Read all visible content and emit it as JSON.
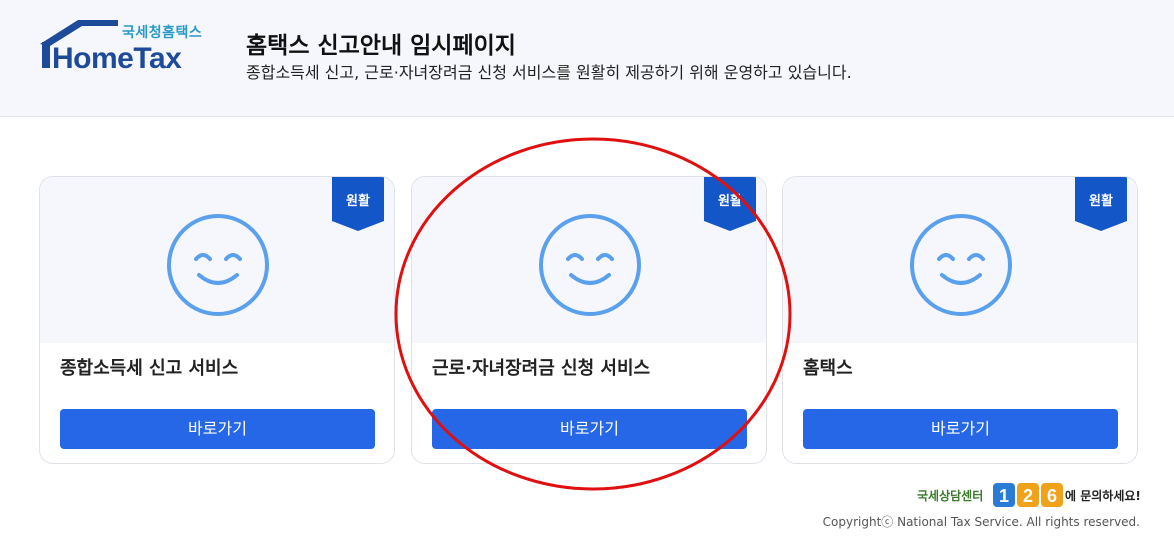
{
  "header": {
    "logo_sub": "국세청홈택스",
    "logo_main": "HomeTax",
    "title": "홈택스 신고안내 임시페이지",
    "description": "종합소득세 신고, 근로·자녀장려금 신청 서비스를 원활히 제공하기 위해 운영하고 있습니다."
  },
  "cards": [
    {
      "status": "원활",
      "title": "종합소득세 신고 서비스",
      "button": "바로가기"
    },
    {
      "status": "원활",
      "title": "근로·자녀장려금 신청 서비스",
      "button": "바로가기"
    },
    {
      "status": "원활",
      "title": "홈택스",
      "button": "바로가기"
    }
  ],
  "footer": {
    "contact_pre": "국세상담센터",
    "contact_number": "126",
    "contact_post": "에 문의하세요!",
    "copyright": "Copyrightⓒ National Tax Service. All rights reserved."
  },
  "colors": {
    "primary_button": "#2567e6",
    "ribbon": "#1356c8",
    "smile": "#5aa0ec",
    "annotation": "#e01010"
  }
}
